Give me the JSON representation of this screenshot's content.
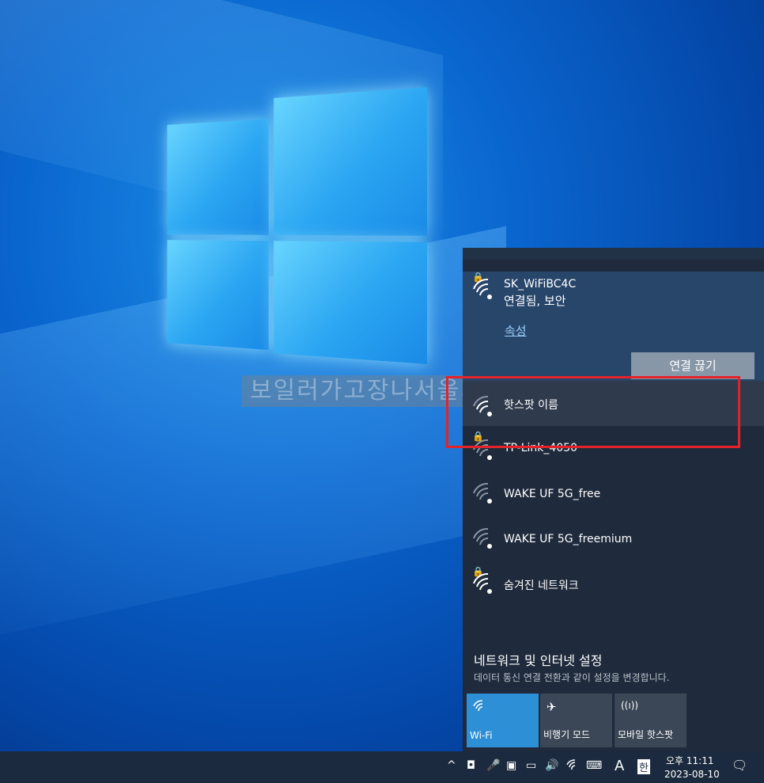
{
  "watermark": "보일러가고장나서울지",
  "networks": {
    "connected": {
      "name": "SK_WiFiBC4C",
      "status": "연결됨, 보안",
      "properties": "속성",
      "disconnect": "연결 끊기"
    },
    "list": [
      {
        "name": "핫스팟 이름",
        "secured": false
      },
      {
        "name": "TP-Link_4050",
        "secured": true
      },
      {
        "name": "WAKE UF 5G_free",
        "secured": false
      },
      {
        "name": "WAKE UF 5G_freemium",
        "secured": false
      },
      {
        "name": "숨겨진 네트워크",
        "secured": true
      }
    ]
  },
  "settings": {
    "title": "네트워크 및 인터넷 설정",
    "description": "데이터 통신 연결 전환과 같이 설정을 변경합니다."
  },
  "quick_actions": [
    {
      "label": "Wi-Fi",
      "active": true,
      "icon": "wifi-icon"
    },
    {
      "label": "비행기 모드",
      "active": false,
      "icon": "airplane-icon"
    },
    {
      "label": "모바일 핫스팟",
      "active": false,
      "icon": "hotspot-icon"
    }
  ],
  "taskbar": {
    "ime_lang": "A",
    "ime_mode": "한",
    "time": "오후 11:11",
    "date": "2023-08-10"
  },
  "colors": {
    "accent": "#2d8fd5",
    "highlight_box": "#e3232a"
  }
}
